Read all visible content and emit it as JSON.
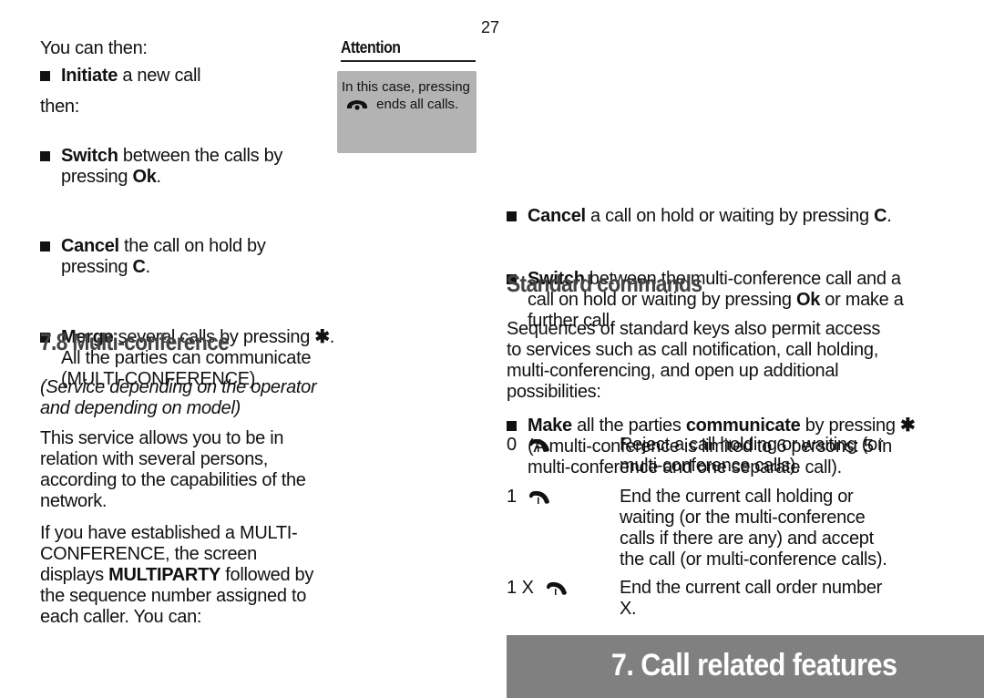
{
  "page_number": "27",
  "left_column": {
    "intro": "You can then:",
    "initiate": {
      "bold": "Initiate",
      "rest": " a new call"
    },
    "then": "then:",
    "bullets": [
      {
        "bold": "Switch",
        "rest": " between the calls by pressing ",
        "key": "Ok",
        "end": "."
      },
      {
        "bold": "Cancel",
        "rest": " the call on hold by pressing ",
        "key": "C",
        "end": "."
      },
      {
        "bold": "Merge",
        "rest": " several calls by pressing ",
        "key": "✱",
        "end": ".  All the parties can communicate (MULTI-CONFERENCE)."
      }
    ],
    "section_heading": "7.8 Multi-conference",
    "note_italic": "(Service depending on the operator and depending on model)",
    "para1": "This service allows you to be in relation with several persons, according to the capabilities of the network.",
    "para2_before": "If you have established a MULTI-CONFERENCE, the screen displays ",
    "para2_bold": "MULTIPARTY",
    "para2_after": " followed by the sequence number assigned to each caller. You can:"
  },
  "attention": {
    "title": "Attention",
    "text_before": "In this case, pressing",
    "icon": "phone-end-icon",
    "text_after": "ends all calls."
  },
  "right_column": {
    "bullets": [
      {
        "bold": "Cancel",
        "rest": " a call on hold or waiting by pressing ",
        "key": "C",
        "end": "."
      },
      {
        "bold": "Switch",
        "rest": " between the multi-conference call and a call on hold or waiting by pressing ",
        "key": "Ok",
        "end": " or make a further call."
      },
      {
        "bold": "Make",
        "rest": " all the parties ",
        "bold2": "communicate",
        "rest2": " by pressing ",
        "key": "✱",
        "end": " (A multi-conference is limited to 6 persons: 5 in multi-conference and one separate call)."
      }
    ],
    "section_heading": "Standard commands",
    "intro": "Sequences of standard keys also permit access to services such as call notification, call holding, multi-conferencing, and open up additional possibilities:",
    "commands": [
      {
        "key": "0",
        "icon": "hang-up-icon",
        "desc": "Reject a call holding or waiting (or multi-conference calls)."
      },
      {
        "key": "1",
        "icon": "hang-up-icon",
        "desc": "End the current call holding or waiting (or the multi-conference calls if there are any) and accept the call (or multi-conference calls)."
      },
      {
        "key": "1 X",
        "icon": "hang-up-icon",
        "desc": "End the current call order number X."
      }
    ]
  },
  "footer": {
    "chapter_title": "7. Call related features",
    "bar_color": "#808080"
  }
}
